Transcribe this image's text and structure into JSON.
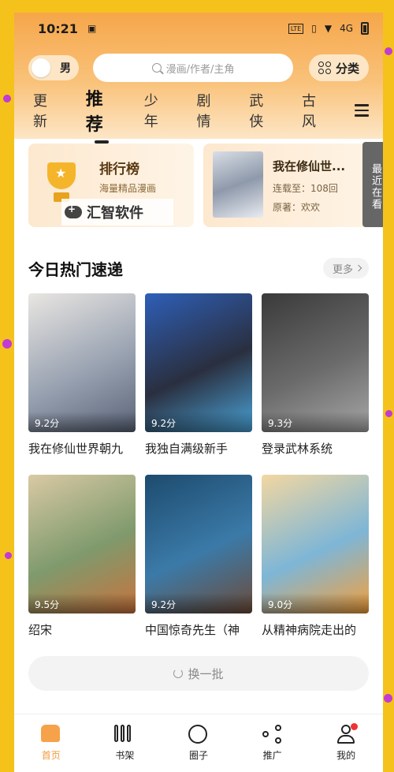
{
  "status_bar": {
    "time": "10:21",
    "network": "4G"
  },
  "header": {
    "gender_label": "男",
    "search_placeholder": "漫画/作者/主角",
    "category_label": "分类",
    "tabs": [
      "更新",
      "推荐",
      "少年",
      "剧情",
      "武侠",
      "古风"
    ],
    "active_tab": "推荐"
  },
  "features": {
    "rank": {
      "title": "排行榜",
      "subtitle": "海量精品漫画"
    },
    "watermark": "汇智软件",
    "recent": {
      "title": "我在修仙世...",
      "serial": "连载至：108回",
      "author": "原著：欢欢",
      "tag": "最近在看"
    }
  },
  "section": {
    "title": "今日热门速递",
    "more_label": "更多"
  },
  "comics": [
    {
      "title": "我在修仙世界朝九",
      "score": "9.2分",
      "colors": [
        "#e9e6e2",
        "#9aa3b2",
        "#5a6478"
      ]
    },
    {
      "title": "我独自满级新手",
      "score": "9.2分",
      "colors": [
        "#2e5fb8",
        "#2a2f3f",
        "#4aa3d8"
      ]
    },
    {
      "title": "登录武林系统",
      "score": "9.3分",
      "colors": [
        "#3a3a3a",
        "#6b6b6b",
        "#a7a7a7"
      ]
    },
    {
      "title": "绍宋",
      "score": "9.5分",
      "colors": [
        "#d9c9a4",
        "#7f9a6d",
        "#c8733d"
      ]
    },
    {
      "title": "中国惊奇先生（神",
      "score": "9.2分",
      "colors": [
        "#1d4b6e",
        "#3b7aa8",
        "#6d4c3a"
      ]
    },
    {
      "title": "从精神病院走出的",
      "score": "9.0分",
      "colors": [
        "#f3d7a1",
        "#7eb6d6",
        "#f4a03b"
      ]
    }
  ],
  "refresh_label": "换一批",
  "bottom_nav": [
    {
      "label": "首页",
      "icon": "home-icon",
      "active": true
    },
    {
      "label": "书架",
      "icon": "bookshelf-icon",
      "active": false
    },
    {
      "label": "圈子",
      "icon": "circle-icon",
      "active": false
    },
    {
      "label": "推广",
      "icon": "share-icon",
      "active": false
    },
    {
      "label": "我的",
      "icon": "profile-icon",
      "active": false
    }
  ],
  "colors": {
    "accent": "#f19a3e",
    "header_top": "#f6a64a",
    "frame": "#f5c21b",
    "notification": "#ee3333"
  }
}
